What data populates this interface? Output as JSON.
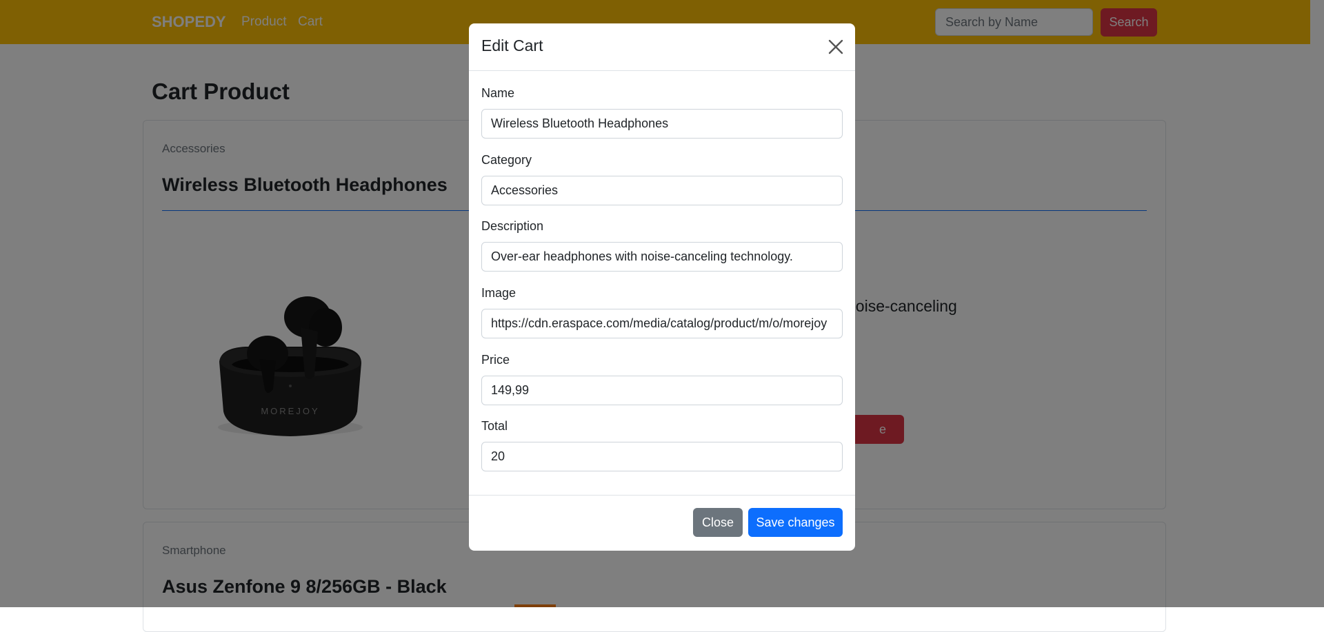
{
  "navbar": {
    "brand": "SHOPEDY",
    "links": [
      "Product",
      "Cart"
    ],
    "search_placeholder": "Search by Name",
    "search_button": "Search"
  },
  "page": {
    "title": "Cart Product"
  },
  "cards": [
    {
      "category": "Accessories",
      "title": "Wireless Bluetooth Headphones",
      "description_fragment": "noise-canceling",
      "image_brand": "MOREJOY",
      "button_fragment": "e"
    },
    {
      "category": "Smartphone",
      "title": "Asus Zenfone 9 8/256GB - Black"
    }
  ],
  "modal": {
    "title": "Edit Cart",
    "fields": [
      {
        "label": "Name",
        "value": "Wireless Bluetooth Headphones"
      },
      {
        "label": "Category",
        "value": "Accessories"
      },
      {
        "label": "Description",
        "value": "Over-ear headphones with noise-canceling technology."
      },
      {
        "label": "Image",
        "value": "https://cdn.eraspace.com/media/catalog/product/m/o/morejoy"
      },
      {
        "label": "Price",
        "value": "149,99"
      },
      {
        "label": "Total",
        "value": "20"
      }
    ],
    "close_button": "Close",
    "save_button": "Save changes"
  },
  "colors": {
    "navbar": "#ffc107",
    "danger": "#dc3545",
    "primary": "#0d6efd",
    "secondary": "#6c757d"
  },
  "icons": {
    "modal_close": "close-icon",
    "product_image": "earbuds-image"
  }
}
